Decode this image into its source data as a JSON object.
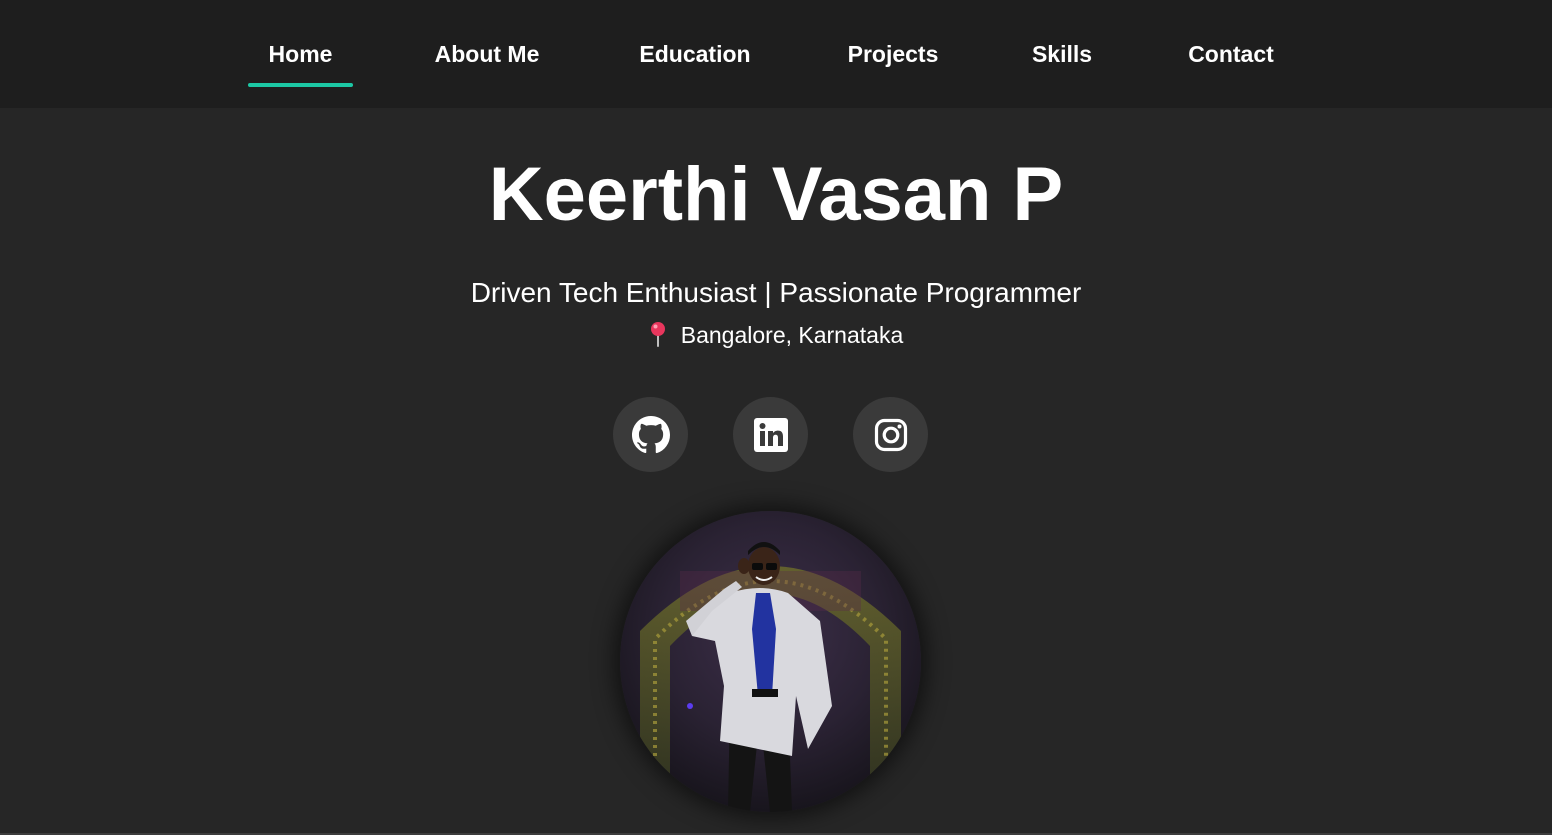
{
  "nav": {
    "items": [
      {
        "label": "Home",
        "active": true
      },
      {
        "label": "About Me",
        "active": false
      },
      {
        "label": "Education",
        "active": false
      },
      {
        "label": "Projects",
        "active": false
      },
      {
        "label": "Skills",
        "active": false
      },
      {
        "label": "Contact",
        "active": false
      }
    ]
  },
  "hero": {
    "name": "Keerthi Vasan P",
    "tagline": "Driven Tech Enthusiast | Passionate Programmer",
    "location": "Bangalore, Karnataka"
  },
  "social": [
    {
      "icon": "github-icon"
    },
    {
      "icon": "linkedin-icon"
    },
    {
      "icon": "instagram-icon"
    }
  ],
  "colors": {
    "background": "#262626",
    "navbar": "#1e1e1e",
    "accent": "#1cc8a5",
    "social_bg": "#3a3a3a"
  }
}
